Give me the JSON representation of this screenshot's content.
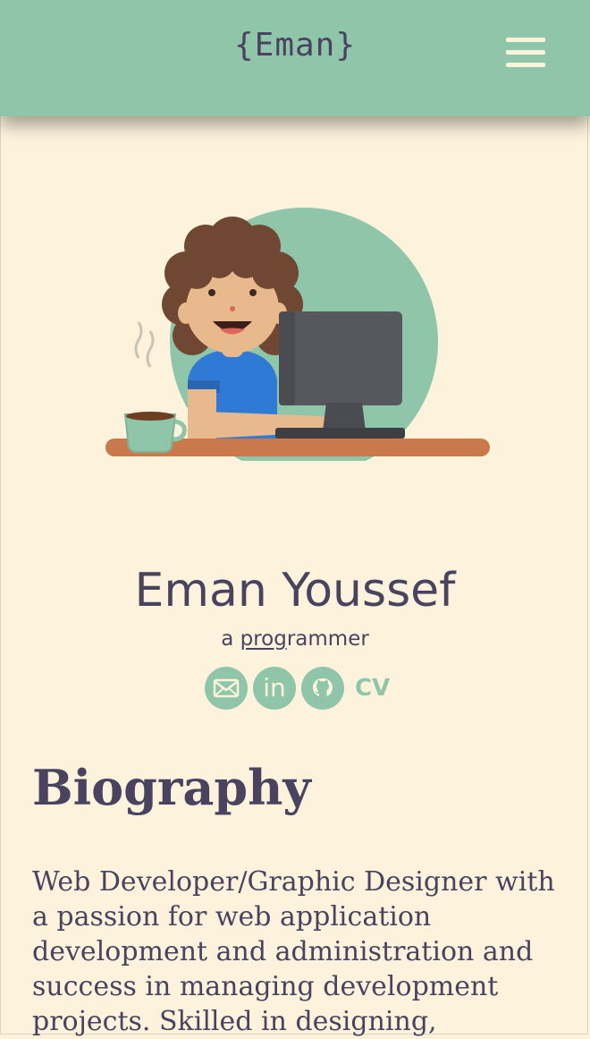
{
  "header": {
    "logo": "{Eman}",
    "menu_icon": "hamburger-menu-icon"
  },
  "colors": {
    "header_bg": "#8fc5a9",
    "page_bg": "#fdf3dc",
    "text": "#4a4360",
    "accent": "#8fc5a9"
  },
  "profile": {
    "name": "Eman Youssef",
    "tagline_prefix": "a ",
    "tagline_underlined": "prog",
    "tagline_suffix": "rammer"
  },
  "socials": [
    {
      "icon": "mail-icon"
    },
    {
      "icon": "linkedin-icon",
      "label": "in"
    },
    {
      "icon": "github-icon"
    }
  ],
  "cv_label": "CV",
  "biography": {
    "heading": "Biography",
    "text": "Web Developer/Graphic Designer with a passion for web application development and administration and success in managing development projects. Skilled in designing,"
  }
}
